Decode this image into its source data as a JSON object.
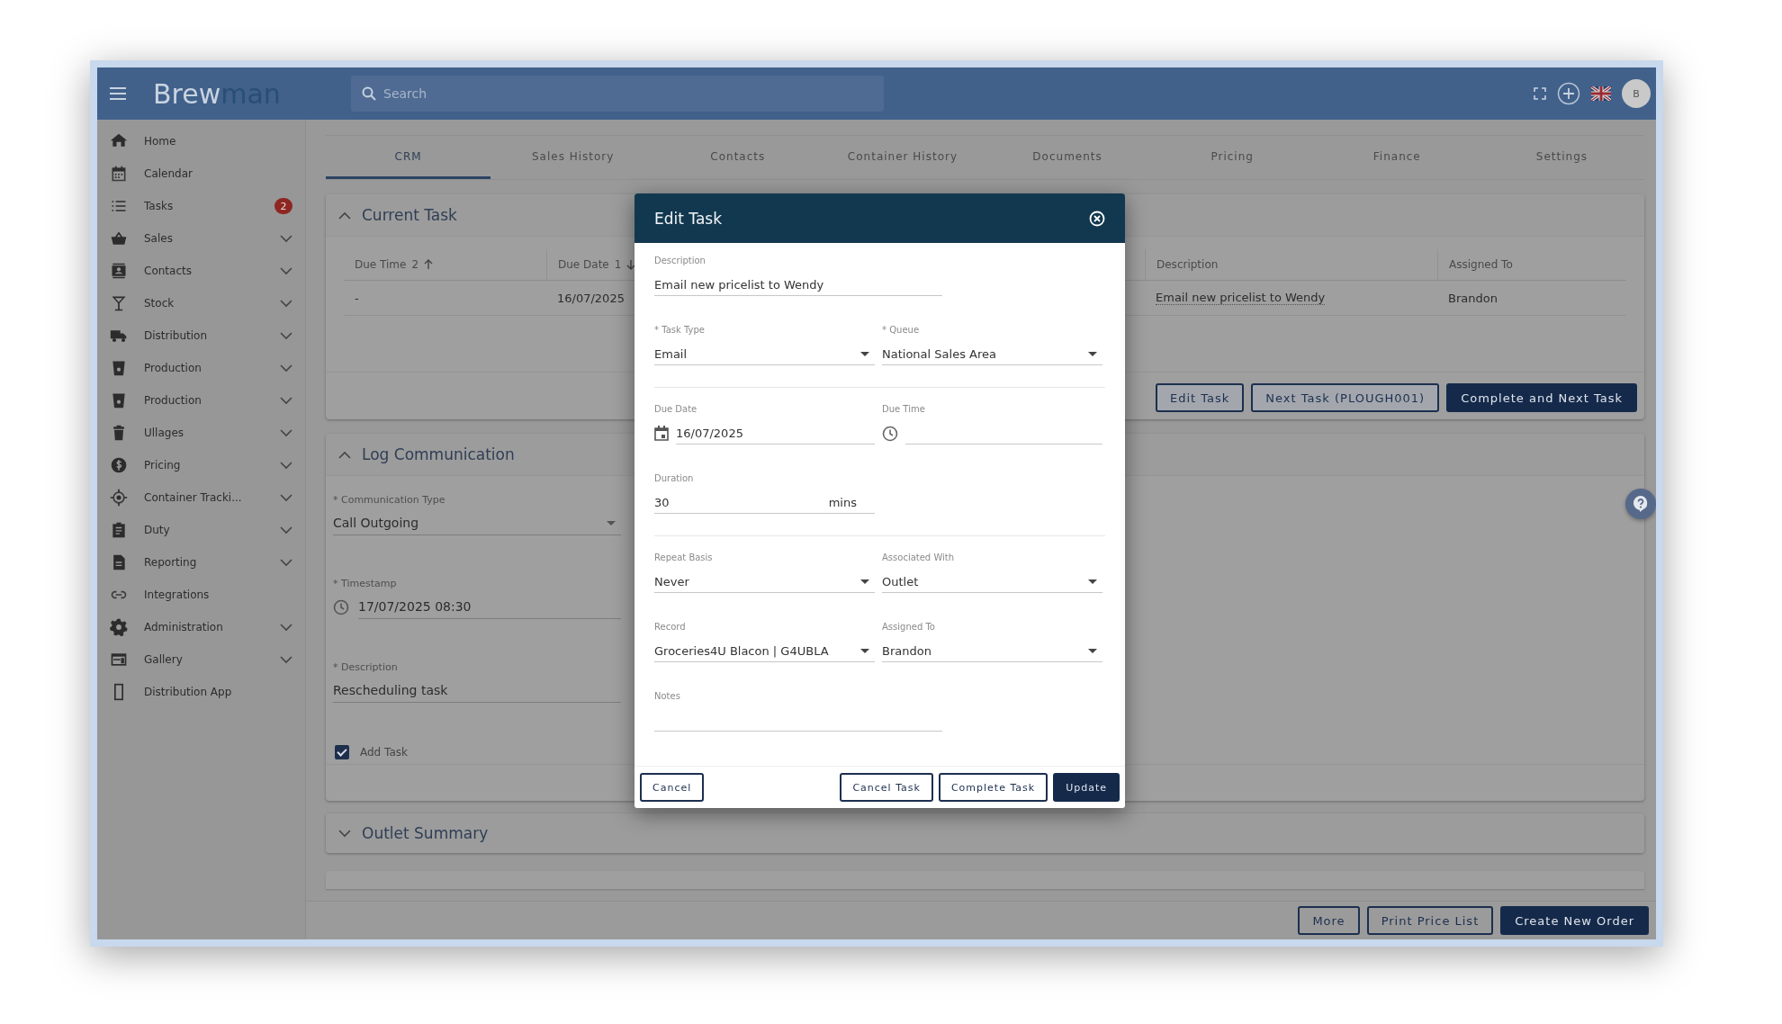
{
  "header": {
    "logo_start": "Brew",
    "logo_end": "man",
    "search": {
      "placeholder": "Search"
    },
    "avatar": "B"
  },
  "sidebar": {
    "items": [
      {
        "label": "Home",
        "expandable": false
      },
      {
        "label": "Calendar",
        "expandable": false
      },
      {
        "label": "Tasks",
        "expandable": false,
        "badge": "2"
      },
      {
        "label": "Sales",
        "expandable": true
      },
      {
        "label": "Contacts",
        "expandable": true
      },
      {
        "label": "Stock",
        "expandable": true
      },
      {
        "label": "Distribution",
        "expandable": true
      },
      {
        "label": "Production",
        "expandable": true
      },
      {
        "label": "Production",
        "expandable": true
      },
      {
        "label": "Ullages",
        "expandable": true
      },
      {
        "label": "Pricing",
        "expandable": true
      },
      {
        "label": "Container Tracki...",
        "expandable": true
      },
      {
        "label": "Duty",
        "expandable": true
      },
      {
        "label": "Reporting",
        "expandable": true
      },
      {
        "label": "Integrations",
        "expandable": false
      },
      {
        "label": "Administration",
        "expandable": true
      },
      {
        "label": "Gallery",
        "expandable": true
      },
      {
        "label": "Distribution App",
        "expandable": false
      }
    ]
  },
  "tabs": [
    {
      "label": "CRM",
      "selected": true
    },
    {
      "label": "Sales History",
      "selected": false
    },
    {
      "label": "Contacts",
      "selected": false
    },
    {
      "label": "Container History",
      "selected": false
    },
    {
      "label": "Documents",
      "selected": false
    },
    {
      "label": "Pricing",
      "selected": false
    },
    {
      "label": "Finance",
      "selected": false
    },
    {
      "label": "Settings",
      "selected": false
    }
  ],
  "current_task": {
    "title": "Current Task",
    "expanded": true,
    "columns": [
      {
        "label": "Due Time",
        "sort_order": "2",
        "ascending": true
      },
      {
        "label": "Due Date",
        "sort_order": "1",
        "ascending": false
      },
      {
        "label": "Description"
      },
      {
        "label": "Assigned To"
      }
    ],
    "rows": [
      [
        "-",
        "16/07/2025",
        "Email new pricelist to Wendy",
        "Brandon"
      ]
    ],
    "buttons": [
      {
        "label": "Edit Task",
        "kind": "outline"
      },
      {
        "label": "Next Task (PLOUGH001)",
        "kind": "outline"
      },
      {
        "label": "Complete and Next Task",
        "kind": "primary"
      }
    ]
  },
  "log_communication": {
    "title": "Log Communication",
    "expanded": true,
    "fields": [
      {
        "kind": "select",
        "label": "* Communication Type",
        "value": "Call Outgoing"
      },
      {
        "kind": "time",
        "label": "* Timestamp",
        "value": "17/07/2025 08:30"
      },
      {
        "kind": "text",
        "label": "* Description",
        "value": "Rescheduling task"
      }
    ],
    "checkbox": {
      "label": "Add Task",
      "checked": true
    }
  },
  "outlet_summary": {
    "title": "Outlet Summary",
    "expanded": false
  },
  "footer_buttons": [
    {
      "label": "More",
      "kind": "outline"
    },
    {
      "label": "Print Price List",
      "kind": "outline"
    },
    {
      "label": "Create New Order",
      "kind": "primary"
    }
  ],
  "dialog": {
    "title": "Edit Task",
    "rows": [
      {
        "divided": false,
        "fields": [
          {
            "kind": "text",
            "label": "Description",
            "value": "Email new pricelist to Wendy"
          }
        ]
      },
      {
        "divided": true,
        "fields": [
          {
            "kind": "select",
            "label": "* Task Type",
            "value": "Email"
          },
          {
            "kind": "select",
            "label": "* Queue",
            "value": "National Sales Area"
          }
        ]
      },
      {
        "divided": false,
        "fields": [
          {
            "kind": "date",
            "label": "Due Date",
            "value": "16/07/2025"
          },
          {
            "kind": "time",
            "label": "Due Time"
          }
        ]
      },
      {
        "divided": true,
        "fields": [
          {
            "kind": "duration",
            "label": "Duration",
            "value": "30",
            "unit": "mins"
          }
        ]
      },
      {
        "divided": false,
        "fields": [
          {
            "kind": "select",
            "label": "Repeat Basis",
            "value": "Never"
          },
          {
            "kind": "select",
            "label": "Associated With",
            "value": "Outlet"
          }
        ]
      },
      {
        "divided": false,
        "fields": [
          {
            "kind": "select",
            "label": "Record",
            "value": "Groceries4U Blacon | G4UBLA"
          },
          {
            "kind": "select",
            "label": "Assigned To",
            "value": "Brandon"
          }
        ]
      },
      {
        "divided": false,
        "fields": [
          {
            "kind": "text",
            "label": "Notes"
          }
        ]
      }
    ],
    "buttons": [
      {
        "label": "Cancel",
        "kind": "outline",
        "left": true
      },
      {
        "label": "Cancel Task",
        "kind": "outline",
        "left": false
      },
      {
        "label": "Complete Task",
        "kind": "outline",
        "left": false
      },
      {
        "label": "Update",
        "kind": "primary",
        "left": false
      }
    ]
  }
}
